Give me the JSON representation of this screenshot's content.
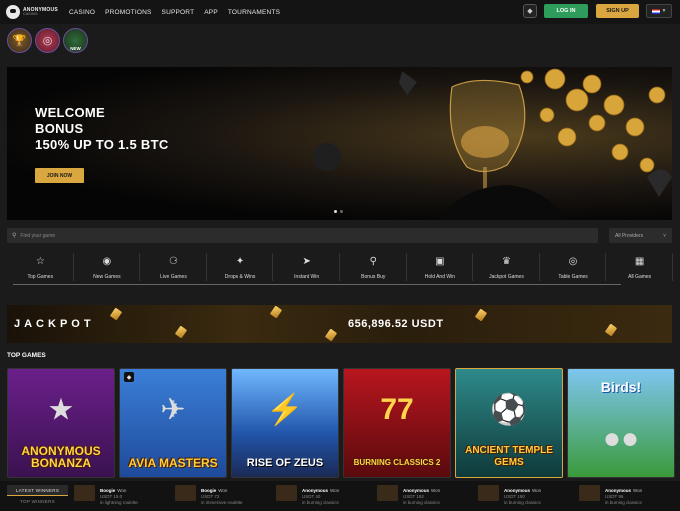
{
  "brand": {
    "name": "ANONYMOUS",
    "sub": "CASINO"
  },
  "nav": [
    "CASINO",
    "PROMOTIONS",
    "SUPPORT",
    "APP",
    "TOURNAMENTS"
  ],
  "auth": {
    "login": "LOG IN",
    "signup": "SIGN UP"
  },
  "quick_icons": [
    {
      "icon": "trophy-icon",
      "label": ""
    },
    {
      "icon": "roulette-icon",
      "label": ""
    },
    {
      "icon": "new-game-icon",
      "label": "NEW"
    }
  ],
  "hero": {
    "line1": "WELCOME",
    "line2": "BONUS",
    "line3": "150% UP TO 1.5 BTC",
    "button": "JOIN NOW"
  },
  "search": {
    "placeholder": "Find your game",
    "providers": "All Providers"
  },
  "categories": [
    {
      "label": "Top Games",
      "icon": "star-icon"
    },
    {
      "label": "New Games",
      "icon": "new-icon"
    },
    {
      "label": "Live Games",
      "icon": "live-icon"
    },
    {
      "label": "Drops & Wins",
      "icon": "drops-icon"
    },
    {
      "label": "Instant Win",
      "icon": "rocket-icon"
    },
    {
      "label": "Bonus Buy",
      "icon": "bonus-buy-icon"
    },
    {
      "label": "Hold And Win",
      "icon": "hold-win-icon"
    },
    {
      "label": "Jackpot Games",
      "icon": "jackpot-icon"
    },
    {
      "label": "Table Games",
      "icon": "table-icon"
    },
    {
      "label": "All Games",
      "icon": "grid-icon"
    }
  ],
  "jackpot": {
    "label": "JACKPOT",
    "amount": "656,896.52 USDT"
  },
  "top_games_title": "TOP GAMES",
  "games": [
    {
      "title": "ANONYMOUS BONANZA"
    },
    {
      "title": "AVIA MASTERS"
    },
    {
      "title": "RISE OF ZEUS"
    },
    {
      "title": "BURNING CLASSICS 2"
    },
    {
      "title": "ANCIENT TEMPLE GEMS"
    },
    {
      "title": "Birds!"
    }
  ],
  "winners": {
    "tabs": [
      "LATEST WINNERS",
      "TOP WINNERS"
    ],
    "items": [
      {
        "name": "Boogie",
        "won": "Won",
        "amount": "USDT 19.0",
        "game": "in lightning roulette"
      },
      {
        "name": "Boogie",
        "won": "Won",
        "amount": "USDT 72",
        "game": "in immersive roulette"
      },
      {
        "name": "Anonymous",
        "won": "Won",
        "amount": "USDT 40",
        "game": "in burning classics"
      },
      {
        "name": "Anonymous",
        "won": "Won",
        "amount": "USDT 192",
        "game": "in burning classics"
      },
      {
        "name": "Anonymous",
        "won": "Won",
        "amount": "USDT 150",
        "game": "in burning classics"
      },
      {
        "name": "Anonymous",
        "won": "Won",
        "amount": "USDT 96",
        "game": "in burning classics"
      }
    ]
  },
  "colors": {
    "accent": "#d9a640",
    "login": "#2e9c5b",
    "bg": "#1b1b1b"
  }
}
